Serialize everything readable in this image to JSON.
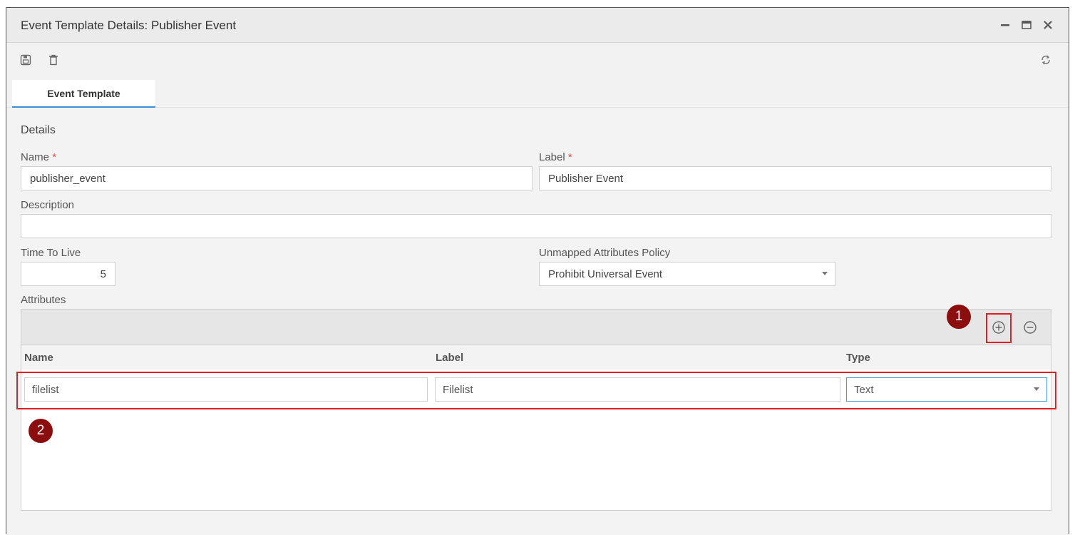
{
  "window": {
    "title": "Event Template Details: Publisher Event"
  },
  "tabs": [
    {
      "label": "Event Template",
      "active": true
    }
  ],
  "details": {
    "section_label": "Details",
    "name_label": "Name",
    "name_value": "publisher_event",
    "label_label": "Label",
    "label_value": "Publisher Event",
    "required_marker": "*",
    "description_label": "Description",
    "description_value": "",
    "ttl_label": "Time To Live",
    "ttl_value": "5",
    "policy_label": "Unmapped Attributes Policy",
    "policy_value": "Prohibit Universal Event",
    "attributes_label": "Attributes"
  },
  "attributes_grid": {
    "columns": [
      "Name",
      "Label",
      "Type"
    ],
    "rows": [
      {
        "name": "filelist",
        "label": "Filelist",
        "type": "Text"
      }
    ]
  },
  "callouts": [
    "1",
    "2"
  ],
  "colors": {
    "accent": "#3b8fd6",
    "callout": "#8b0d0d",
    "highlight": "#e02020",
    "required": "#d9534f"
  },
  "icons": [
    "minimize-icon",
    "maximize-icon",
    "close-icon",
    "save-icon",
    "delete-icon",
    "refresh-icon",
    "add-circle-icon",
    "remove-circle-icon",
    "dropdown-caret-icon"
  ]
}
